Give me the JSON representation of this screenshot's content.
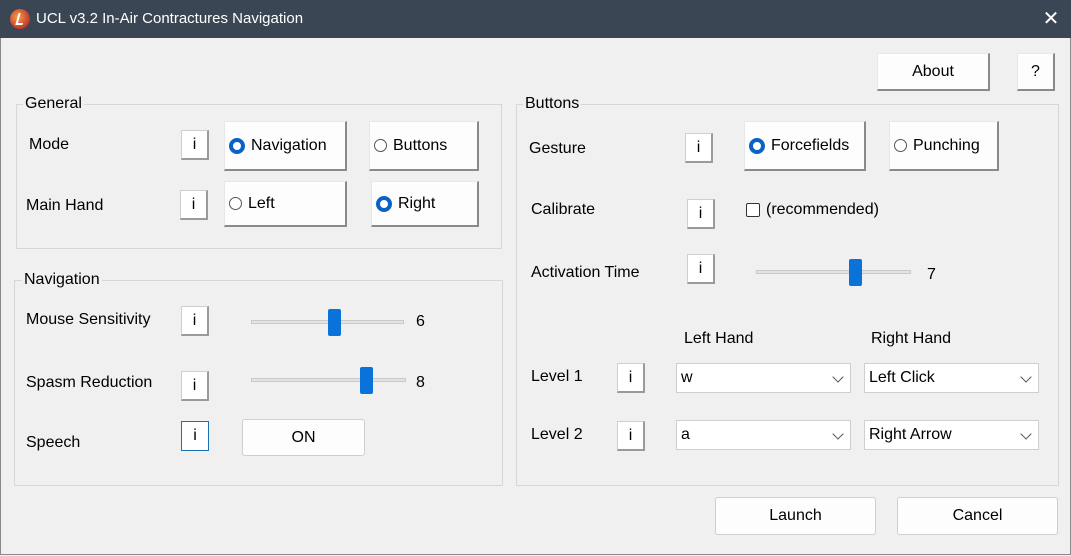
{
  "window": {
    "title": "UCL v3.2 In-Air Contractures Navigation",
    "close_glyph": "✕"
  },
  "top_buttons": {
    "about": "About",
    "help": "?"
  },
  "info_glyph": "i",
  "general": {
    "legend": "General",
    "mode_label": "Mode",
    "mode_options": [
      "Navigation",
      "Buttons"
    ],
    "mode_selected": "Navigation",
    "hand_label": "Main Hand",
    "hand_options": [
      "Left",
      "Right"
    ],
    "hand_selected": "Right"
  },
  "navigation": {
    "legend": "Navigation",
    "mouse_sensitivity": {
      "label": "Mouse Sensitivity",
      "value": "6",
      "level": 6,
      "max": 10
    },
    "spasm_reduction": {
      "label": "Spasm Reduction",
      "value": "8",
      "level": 8,
      "max": 10
    },
    "speech": {
      "label": "Speech",
      "toggle": "ON"
    }
  },
  "buttons": {
    "legend": "Buttons",
    "gesture_label": "Gesture",
    "gesture_options": [
      "Forcefields",
      "Punching"
    ],
    "gesture_selected": "Forcefields",
    "calibrate_label": "Calibrate",
    "calibrate_checkbox": "(recommended)",
    "calibrate_checked": false,
    "activation": {
      "label": "Activation Time",
      "value": "7",
      "level": 7,
      "max": 10
    },
    "col_left": "Left Hand",
    "col_right": "Right Hand",
    "levels": [
      {
        "label": "Level 1",
        "left": "w",
        "right": "Left Click"
      },
      {
        "label": "Level 2",
        "left": "a",
        "right": "Right Arrow"
      }
    ]
  },
  "footer": {
    "launch": "Launch",
    "cancel": "Cancel"
  },
  "colors": {
    "titlebar": "#3b4654",
    "accent": "#0a72d8",
    "background": "#f0f0f0"
  }
}
